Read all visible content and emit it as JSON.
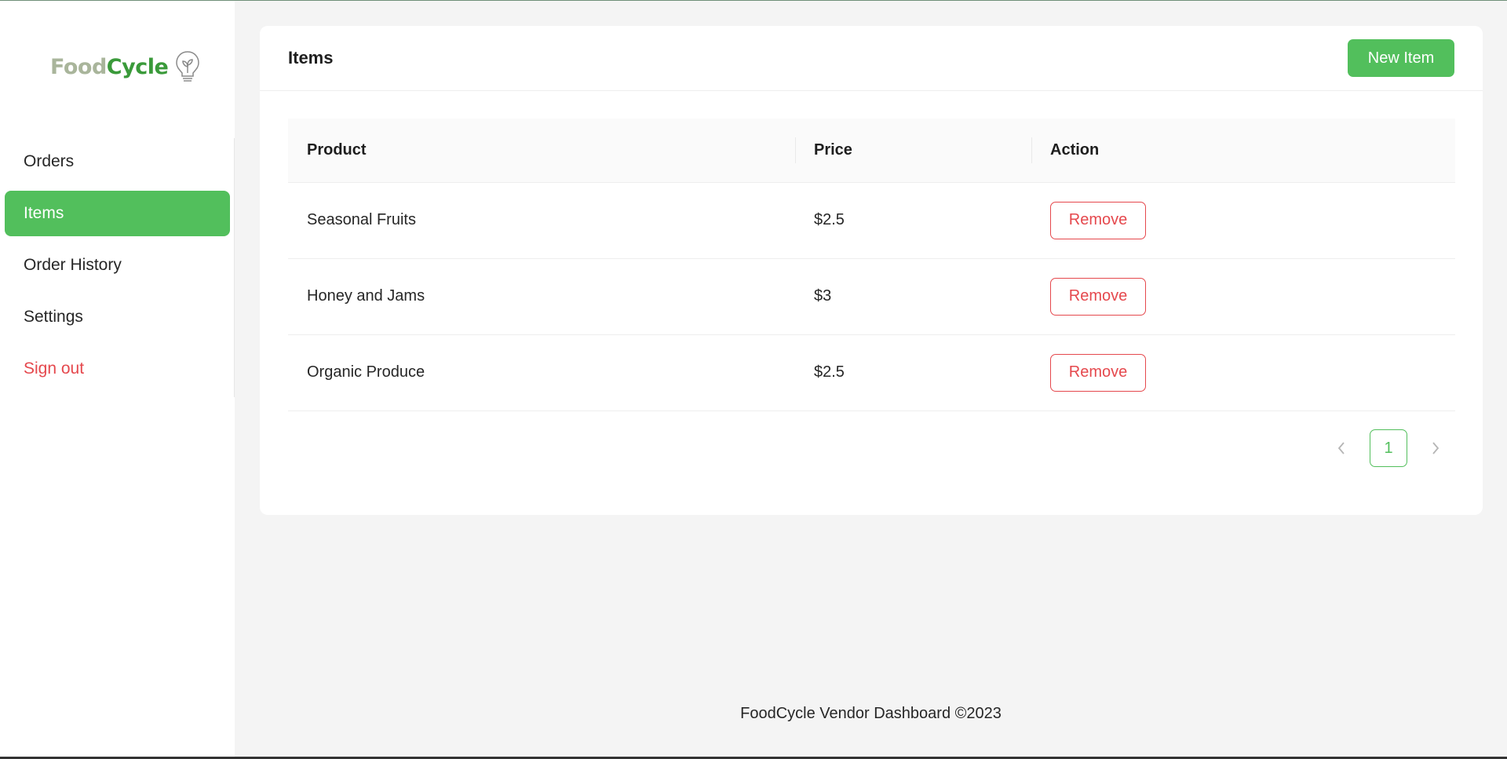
{
  "brand": {
    "name_part1": "Food",
    "name_part2": "Cycle",
    "icon": "lightbulb-sprout-icon",
    "colors": {
      "part1": "#a9b59b",
      "part2": "#3a9a3a"
    }
  },
  "sidebar": {
    "items": [
      {
        "label": "Orders",
        "active": false
      },
      {
        "label": "Items",
        "active": true
      },
      {
        "label": "Order History",
        "active": false
      },
      {
        "label": "Settings",
        "active": false
      },
      {
        "label": "Sign out",
        "active": false
      }
    ]
  },
  "page": {
    "title": "Items",
    "new_item_label": "New Item"
  },
  "table": {
    "columns": [
      "Product",
      "Price",
      "Action"
    ],
    "rows": [
      {
        "product": "Seasonal Fruits",
        "price": "$2.5",
        "action": "Remove"
      },
      {
        "product": "Honey and Jams",
        "price": "$3",
        "action": "Remove"
      },
      {
        "product": "Organic Produce",
        "price": "$2.5",
        "action": "Remove"
      }
    ]
  },
  "pagination": {
    "current_page": "1",
    "prev_icon": "chevron-left-icon",
    "next_icon": "chevron-right-icon"
  },
  "footer": {
    "text": "FoodCycle Vendor Dashboard ©2023"
  },
  "colors": {
    "accent": "#52bf5c",
    "danger": "#e5484d",
    "background": "#f4f4f4"
  }
}
